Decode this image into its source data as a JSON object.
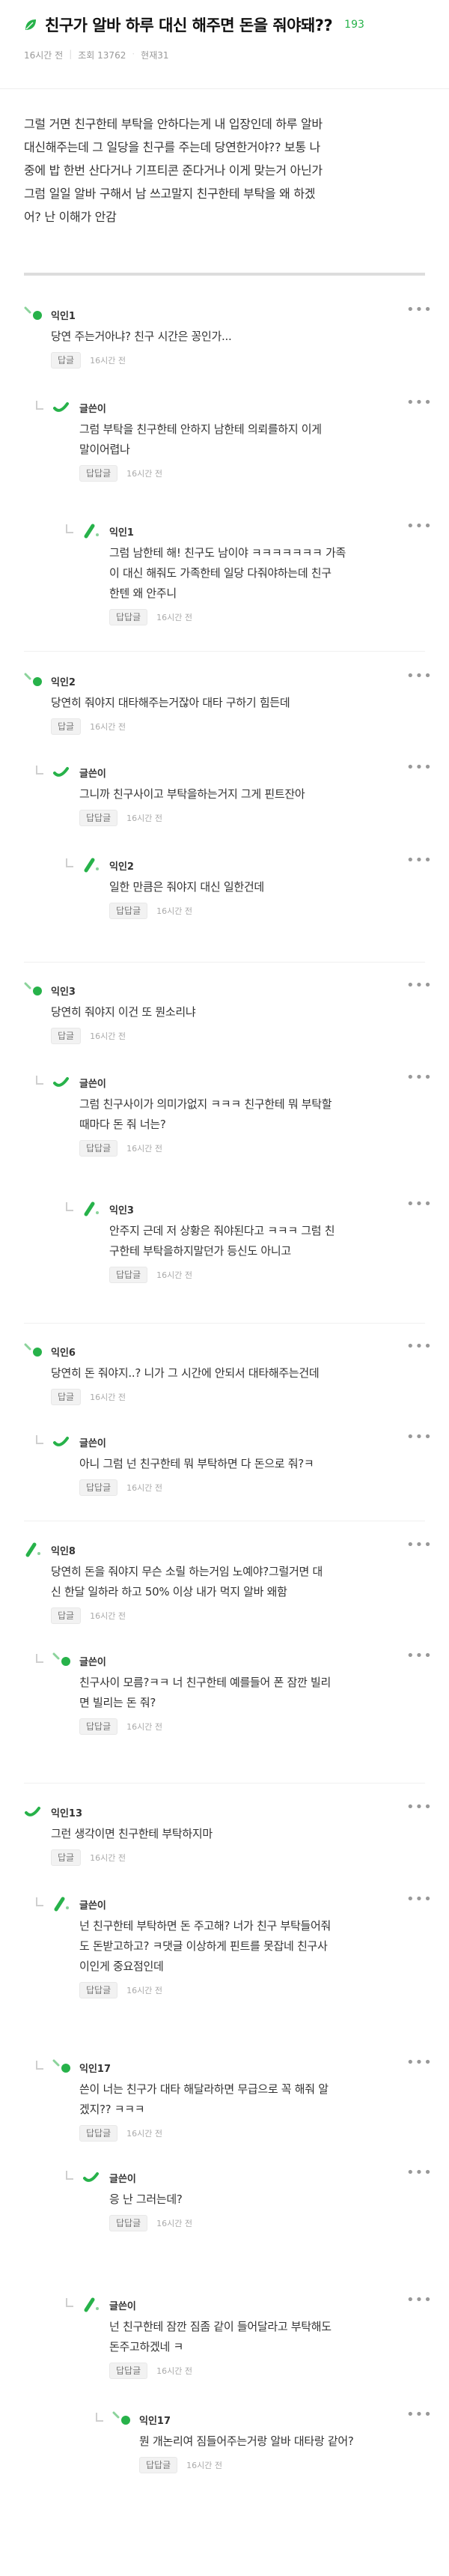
{
  "post": {
    "title": "친구가 알바 하루 대신 해주면 돈을 줘야돼??",
    "comment_count": "193",
    "time": "16시간 전",
    "views": "조회 13762",
    "recommend": "현재31",
    "body_lines": [
      "그럴 거면 친구한테 부탁을 안하다는게 내 입장인데 하루 알바",
      "대신해주는데 그 일당을 친구를 주는데 당연한거야?? 보통 나",
      "중에 밥 한번 산다거나 기프티콘 준다거나 이게 맞는거 아닌가",
      "그럼 일일 알바 구해서 남 쓰고말지 친구한테 부탁을 왜 하겠",
      "어? 난 이해가 안감"
    ]
  },
  "ui": {
    "reply_label": "답글",
    "rereply_label": "답답글",
    "more_label": "•••",
    "icon_color": "#27b24a"
  },
  "comments": [
    {
      "author": "익인1",
      "lines": [
        "당연 주는거아냐? 친구 시간은 꽁인가..."
      ],
      "time": "16시간 전"
    },
    {
      "author": "글쓴이",
      "lines": [
        "그럼 부탁을 친구한테 안하지 남한테 의뢰를하지 이게",
        "말이어렵나"
      ],
      "time": "16시간 전"
    },
    {
      "author": "익인1",
      "lines": [
        "그럼 남한테 해! 친구도 남이야 ㅋㅋㅋㅋㅋㅋㅋ 가족",
        "이 대신 해줘도 가족한테 일당 다줘야하는데 친구",
        "한텐 왜 안주니"
      ],
      "time": "16시간 전"
    },
    {
      "author": "익인2",
      "lines": [
        "당연히 줘야지 대타해주는거잖아 대타 구하기 힘든데"
      ],
      "time": "16시간 전"
    },
    {
      "author": "글쓴이",
      "lines": [
        "그니까 친구사이고 부탁을하는거지 그게 핀트잔아"
      ],
      "time": "16시간 전"
    },
    {
      "author": "익인2",
      "lines": [
        "일한 만큼은 줘야지 대신 일한건데"
      ],
      "time": "16시간 전"
    },
    {
      "author": "익인3",
      "lines": [
        "당연히 줘야지 이건 또 뭔소리냐"
      ],
      "time": "16시간 전"
    },
    {
      "author": "글쓴이",
      "lines": [
        "그럼 친구사이가 의미가없지 ㅋㅋㅋ 친구한테 뭐 부탁할",
        "때마다 돈 줘 너는?"
      ],
      "time": "16시간 전"
    },
    {
      "author": "익인3",
      "lines": [
        "안주지 근데 저 상황은 줘야된다고 ㅋㅋㅋ 그럼 친",
        "구한테 부탁을하지말던가 등신도 아니고"
      ],
      "time": "16시간 전"
    },
    {
      "author": "익인6",
      "lines": [
        "당연히 돈 줘야지..? 니가 그 시간에 안되서 대타해주는건데"
      ],
      "time": "16시간 전"
    },
    {
      "author": "글쓴이",
      "lines": [
        "아니 그럼 넌 친구한테 뭐 부탁하면 다 돈으로 줘?ㅋ"
      ],
      "time": "16시간 전"
    },
    {
      "author": "익인8",
      "lines": [
        "당연히 돈을 줘야지 무슨 소릴 하는거임 노예야?그럴거면 대",
        "신 한달 일하라 하고 50% 이상 내가 먹지 알바 왜함"
      ],
      "time": "16시간 전"
    },
    {
      "author": "글쓴이",
      "lines": [
        "친구사이 모름?ㅋㅋ 너 친구한테 예를들어 폰 잠깐 빌리",
        "면 빌리는 돈 줘?"
      ],
      "time": "16시간 전"
    },
    {
      "author": "익인13",
      "lines": [
        "그런 생각이면 친구한테 부탁하지마"
      ],
      "time": "16시간 전"
    },
    {
      "author": "글쓴이",
      "lines": [
        "넌 친구한테 부탁하면 돈 주고해? 너가 친구 부탁들어줘",
        "도 돈받고하고? ㅋ댓글 이상하게 핀트를 못잡네 친구사",
        "이인게 중요점인데"
      ],
      "time": "16시간 전"
    },
    {
      "author": "익인17",
      "lines": [
        "쓴이 너는 친구가 대타 해달라하면 무급으로 꼭 해줘 알",
        "겠지?? ㅋㅋㅋ"
      ],
      "time": "16시간 전"
    },
    {
      "author": "글쓴이",
      "lines": [
        "응 난 그러는데?"
      ],
      "time": "16시간 전"
    },
    {
      "author": "글쓴이",
      "lines": [
        "넌 친구한테 잠깐 짐좀 같이 들어달라고 부탁해도",
        "돈주고하겠네 ㅋ"
      ],
      "time": "16시간 전"
    },
    {
      "author": "익인17",
      "lines": [
        "뭔 개논리여 짐들어주는거랑 알바 대타랑 같어?"
      ],
      "time": "16시간 전"
    }
  ]
}
